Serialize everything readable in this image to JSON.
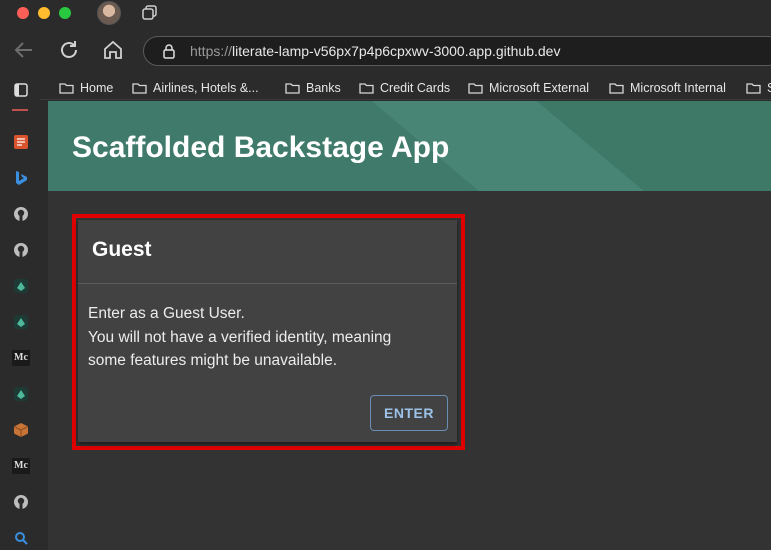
{
  "browser": {
    "url_protocol": "https://",
    "url_host": "literate-lamp-v56px7p4p6cpxwv-3000.app.github.dev"
  },
  "bookmarks": [
    {
      "label": "Home"
    },
    {
      "label": "Airlines, Hotels &..."
    },
    {
      "label": "Banks"
    },
    {
      "label": "Credit Cards"
    },
    {
      "label": "Microsoft External"
    },
    {
      "label": "Microsoft Internal"
    },
    {
      "label": "S"
    }
  ],
  "sidebar": {
    "icons": [
      "tabs-icon",
      "notes-icon",
      "bing-icon",
      "github-icon",
      "github-icon",
      "codespaces-icon",
      "codespaces-icon",
      "medium-icon",
      "codespaces-icon",
      "box-icon",
      "medium-icon",
      "github-icon",
      "search-icon"
    ],
    "medium_label": "Mc"
  },
  "app": {
    "title": "Scaffolded Backstage App"
  },
  "guest_card": {
    "title": "Guest",
    "line1": "Enter as a Guest User.",
    "line2": "You will not have a verified identity, meaning",
    "line3": "some features might be unavailable.",
    "button_label": "ENTER"
  },
  "colors": {
    "header_bg": "#3f7a6a",
    "highlight_border": "#e00000",
    "button_text": "#9cc2ea"
  }
}
